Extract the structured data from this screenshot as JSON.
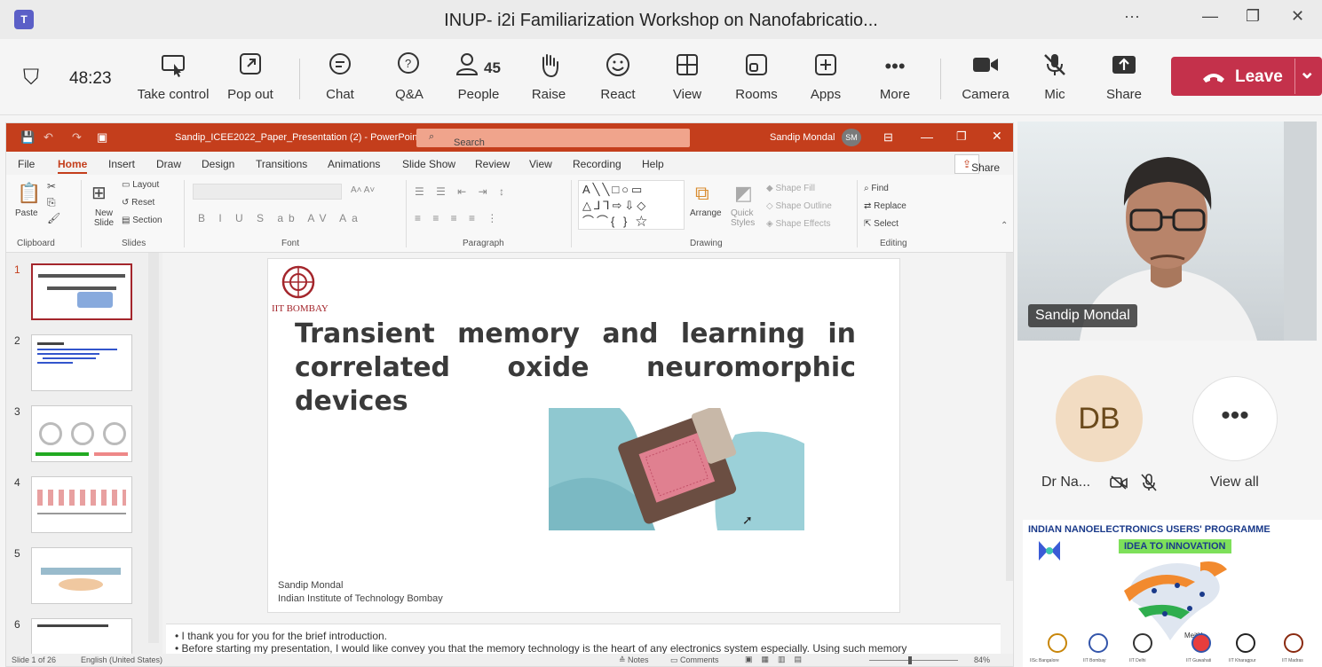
{
  "window": {
    "title": "INUP- i2i Familiarization Workshop on Nanofabricatio...",
    "dots": "···",
    "minimize": "—",
    "restore": "❐",
    "close": "✕"
  },
  "toolbar": {
    "shield": "⛉",
    "timer": "48:23",
    "take_control": "Take control",
    "pop_out": "Pop out",
    "chat": "Chat",
    "qa": "Q&A",
    "people": "People",
    "people_count": "45",
    "raise": "Raise",
    "react": "React",
    "view": "View",
    "rooms": "Rooms",
    "apps": "Apps",
    "more": "More",
    "camera": "Camera",
    "mic": "Mic",
    "share": "Share",
    "leave": "Leave",
    "chevron": "⌄"
  },
  "ppt": {
    "doc_title": "Sandip_ICEE2022_Paper_Presentation (2)  -  PowerPoint",
    "search": "Search",
    "user": "Sandip Mondal",
    "user_initials": "SM",
    "tabs": [
      "File",
      "Home",
      "Insert",
      "Draw",
      "Design",
      "Transitions",
      "Animations",
      "Slide Show",
      "Review",
      "View",
      "Recording",
      "Help"
    ],
    "share": "Share",
    "ribbon": {
      "paste": "Paste",
      "clipboard": "Clipboard",
      "new_slide": "New Slide",
      "layout": "Layout",
      "reset": "Reset",
      "section": "Section",
      "slides": "Slides",
      "font": "Font",
      "paragraph": "Paragraph",
      "arrange": "Arrange",
      "quick_styles": "Quick Styles",
      "shape_fill": "Shape Fill",
      "shape_outline": "Shape Outline",
      "shape_effects": "Shape Effects",
      "drawing": "Drawing",
      "find": "Find",
      "replace": "Replace",
      "select": "Select",
      "editing": "Editing"
    },
    "thumb_numbers": [
      "1",
      "2",
      "3",
      "4",
      "5",
      "6"
    ],
    "slide": {
      "logo": "IIT BOMBAY",
      "title": "Transient memory and learning in correlated oxide neuromorphic devices",
      "author": "Sandip Mondal",
      "affiliation": "Indian Institute of Technology Bombay"
    },
    "notes": [
      "I thank you for you for the brief introduction.",
      "Before starting my presentation, I would like convey you that the memory technology is the heart of any electronics system especially. Using such memory"
    ],
    "status": {
      "slide": "Slide 1 of 26",
      "lang": "English (United States)",
      "notes": "Notes",
      "comments": "Comments",
      "zoom": "84%"
    }
  },
  "participants": {
    "video_name": "Sandip Mondal",
    "avatar_initials": "DB",
    "avatar_name": "Dr Na...",
    "view_all": "View all"
  },
  "inup": {
    "title": "INDIAN NANOELECTRONICS USERS' PROGRAMME",
    "tagline": "IDEA TO INNOVATION",
    "meity": "MeitY",
    "institutes": [
      "IISc Bangalore",
      "IIT Bombay",
      "IIT Delhi",
      "IIT Guwahati",
      "IIT Kharagpur",
      "IIT Madras"
    ]
  }
}
